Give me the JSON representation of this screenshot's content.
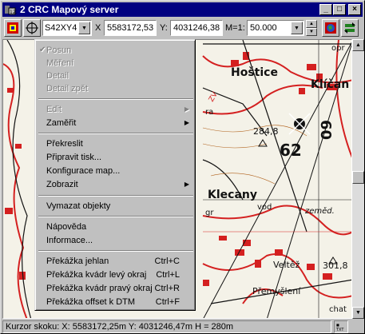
{
  "window": {
    "title": "2 CRC Mapový server",
    "minimize": "_",
    "maximize": "□",
    "close": "×"
  },
  "toolbar": {
    "projection": "S42XY4",
    "x_label": "X",
    "x_value": "5583172,53",
    "y_label": "Y:",
    "y_value": "4031246,38",
    "scale_label": "M=1:",
    "scale_value": "50.000"
  },
  "map": {
    "labels": {
      "hostice": "Hoštice",
      "klican": "Klíčan",
      "klecany": "Klecany",
      "veltez": "Veltěž",
      "premysleni": "Přemyšlení",
      "zemed": "zeměd.",
      "height_284": "284,8",
      "height_301": "301,8",
      "grid_62": "62",
      "grid_60": "60",
      "zv": "ZV",
      "ra": "ra",
      "gr": "gr",
      "opr": "opr",
      "vod": "vod",
      "chat": "chat"
    }
  },
  "menu": {
    "items": [
      {
        "label": "Posun",
        "state": "disabled",
        "checked": true
      },
      {
        "label": "Měření",
        "state": "disabled"
      },
      {
        "label": "Detail",
        "state": "disabled"
      },
      {
        "label": "Detail zpět",
        "state": "disabled"
      },
      {
        "label": "Edit",
        "state": "disabled",
        "submenu": true
      },
      {
        "label": "Zaměřit",
        "state": "enabled",
        "submenu": true
      },
      {
        "label": "Překreslit",
        "state": "enabled"
      },
      {
        "label": "Připravit tisk...",
        "state": "enabled"
      },
      {
        "label": "Konfigurace map...",
        "state": "enabled"
      },
      {
        "label": "Zobrazit",
        "state": "enabled",
        "submenu": true
      },
      {
        "label": "Vymazat objekty",
        "state": "enabled"
      },
      {
        "label": "Nápověda",
        "state": "enabled"
      },
      {
        "label": "Informace...",
        "state": "enabled"
      },
      {
        "label": "Překážka jehlan",
        "shortcut": "Ctrl+C"
      },
      {
        "label": "Překážka kvádr levý okraj",
        "shortcut": "Ctrl+L"
      },
      {
        "label": "Překážka kvádr pravý okraj",
        "shortcut": "Ctrl+R"
      },
      {
        "label": "Překážka offset k DTM",
        "shortcut": "Ctrl+F"
      }
    ],
    "submenu_arrow": "▶",
    "check_mark": "✔"
  },
  "status": {
    "text": "Kurzor skoku: X: 5583172,25m  Y: 4031246,47m  H = 280m"
  },
  "colors": {
    "title_bar": "#000080",
    "map_red": "#d42020",
    "map_black": "#111111",
    "map_bg": "#f4f2e8"
  }
}
